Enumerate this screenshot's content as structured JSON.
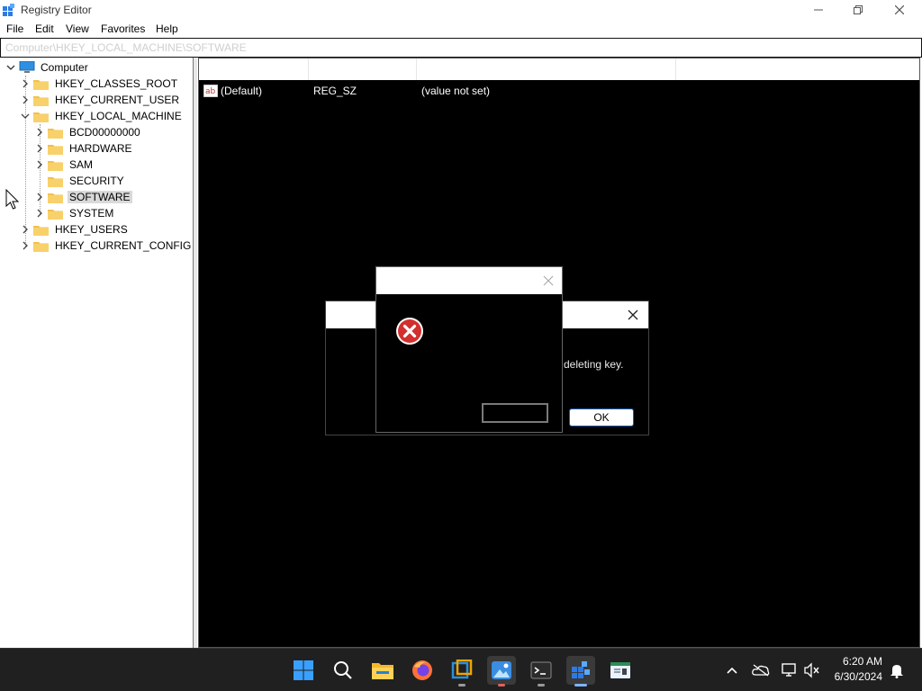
{
  "window": {
    "title": "Registry Editor",
    "controls": [
      "minimize",
      "restore",
      "close"
    ]
  },
  "menu": {
    "items": [
      "File",
      "Edit",
      "View",
      "Favorites",
      "Help"
    ]
  },
  "address": {
    "path": "Computer\\HKEY_LOCAL_MACHINE\\SOFTWARE"
  },
  "tree": {
    "root": "Computer",
    "hives": [
      {
        "label": "HKEY_CLASSES_ROOT",
        "expanded": false
      },
      {
        "label": "HKEY_CURRENT_USER",
        "expanded": false
      },
      {
        "label": "HKEY_LOCAL_MACHINE",
        "expanded": true,
        "children": [
          "BCD00000000",
          "HARDWARE",
          "SAM",
          "SECURITY",
          "SOFTWARE",
          "SYSTEM"
        ]
      },
      {
        "label": "HKEY_USERS",
        "expanded": false
      },
      {
        "label": "HKEY_CURRENT_CONFIG",
        "expanded": false
      }
    ],
    "selected": "SOFTWARE"
  },
  "values": {
    "rows": [
      {
        "name": "(Default)",
        "type": "REG_SZ",
        "data": "(value not set)"
      }
    ]
  },
  "dialog_back": {
    "message_fragment": "deleting key.",
    "ok_label": "OK"
  },
  "dialog_front": {
    "icon": "error-icon"
  },
  "taskbar": {
    "apps": [
      "start-icon",
      "search-icon",
      "file-explorer-icon",
      "firefox-icon",
      "virtualbox-icon",
      "photos-icon",
      "terminal-icon",
      "registry-editor-icon",
      "notepad-icon"
    ],
    "tray": [
      "chevron-up-icon",
      "onedrive-icon",
      "network-icon",
      "volume-muted-icon",
      "notification-bell-icon"
    ],
    "time": "6:20 AM",
    "date": "6/30/2024"
  },
  "colors": {
    "accent": "#1a5fb4",
    "error": "#d32f2f",
    "folder": "#f3c04a",
    "taskbar": "#202020"
  }
}
